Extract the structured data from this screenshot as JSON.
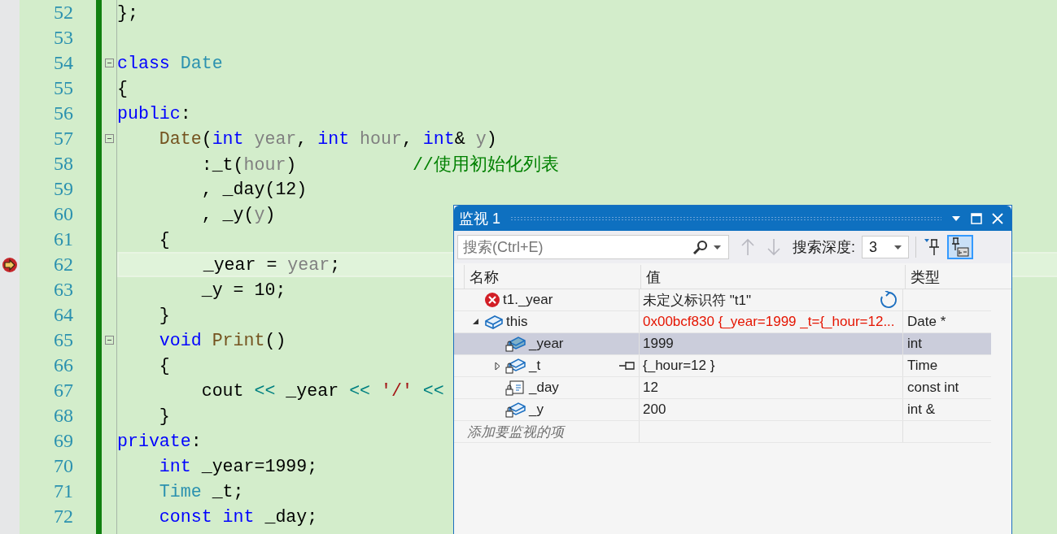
{
  "editor": {
    "lines": [
      {
        "number": "52",
        "tokens": [
          {
            "kind": "plain",
            "text": "};"
          }
        ]
      },
      {
        "number": "53"
      },
      {
        "number": "54",
        "foldable": true,
        "tokens": [
          {
            "kind": "keyword",
            "text": "class "
          },
          {
            "kind": "type",
            "text": "Date"
          }
        ]
      },
      {
        "number": "55",
        "tokens": [
          {
            "kind": "plain",
            "text": "{"
          }
        ]
      },
      {
        "number": "56",
        "tokens": [
          {
            "kind": "keyword",
            "text": "public"
          },
          {
            "kind": "plain",
            "text": ":"
          }
        ]
      },
      {
        "number": "57",
        "foldable": true,
        "tokens": [
          {
            "kind": "function",
            "text": "    Date"
          },
          {
            "kind": "plain",
            "text": "("
          },
          {
            "kind": "keyword",
            "text": "int "
          },
          {
            "kind": "param",
            "text": "year"
          },
          {
            "kind": "plain",
            "text": ", "
          },
          {
            "kind": "keyword",
            "text": "int "
          },
          {
            "kind": "param",
            "text": "hour"
          },
          {
            "kind": "plain",
            "text": ", "
          },
          {
            "kind": "keyword",
            "text": "int"
          },
          {
            "kind": "plain",
            "text": "& "
          },
          {
            "kind": "param",
            "text": "y"
          },
          {
            "kind": "plain",
            "text": ")"
          }
        ]
      },
      {
        "number": "58",
        "tokens": [
          {
            "kind": "plain",
            "text": "        :_t("
          },
          {
            "kind": "param",
            "text": "hour"
          },
          {
            "kind": "plain",
            "text": ")           "
          },
          {
            "kind": "comment",
            "text": "//使用初始化列表"
          }
        ]
      },
      {
        "number": "59",
        "tokens": [
          {
            "kind": "plain",
            "text": "        , _day(12)"
          }
        ]
      },
      {
        "number": "60",
        "tokens": [
          {
            "kind": "plain",
            "text": "        , _y("
          },
          {
            "kind": "param",
            "text": "y"
          },
          {
            "kind": "plain",
            "text": ")"
          }
        ]
      },
      {
        "number": "61",
        "tokens": [
          {
            "kind": "plain",
            "text": "    {"
          }
        ]
      },
      {
        "number": "62",
        "current": true,
        "tokens": [
          {
            "kind": "plain",
            "text": "        _year = "
          },
          {
            "kind": "param",
            "text": "year"
          },
          {
            "kind": "plain",
            "text": ";"
          }
        ]
      },
      {
        "number": "63",
        "tokens": [
          {
            "kind": "plain",
            "text": "        _y = 10;"
          }
        ]
      },
      {
        "number": "64",
        "tokens": [
          {
            "kind": "plain",
            "text": "    }"
          }
        ]
      },
      {
        "number": "65",
        "foldable": true,
        "tokens": [
          {
            "kind": "keyword",
            "text": "    void "
          },
          {
            "kind": "function",
            "text": "Print"
          },
          {
            "kind": "plain",
            "text": "()"
          }
        ]
      },
      {
        "number": "66",
        "tokens": [
          {
            "kind": "plain",
            "text": "    {"
          }
        ]
      },
      {
        "number": "67",
        "tokens": [
          {
            "kind": "plain",
            "text": "        cout "
          },
          {
            "kind": "operator",
            "text": "<< "
          },
          {
            "kind": "plain",
            "text": "_year "
          },
          {
            "kind": "operator",
            "text": "<< "
          },
          {
            "kind": "string",
            "text": "'/' "
          },
          {
            "kind": "operator",
            "text": "<<"
          }
        ]
      },
      {
        "number": "68",
        "tokens": [
          {
            "kind": "plain",
            "text": "    }"
          }
        ]
      },
      {
        "number": "69",
        "tokens": [
          {
            "kind": "keyword",
            "text": "private"
          },
          {
            "kind": "plain",
            "text": ":"
          }
        ]
      },
      {
        "number": "70",
        "tokens": [
          {
            "kind": "keyword",
            "text": "    int "
          },
          {
            "kind": "plain",
            "text": "_year=1999;"
          }
        ]
      },
      {
        "number": "71",
        "tokens": [
          {
            "kind": "type",
            "text": "    Time "
          },
          {
            "kind": "plain",
            "text": "_t;"
          }
        ]
      },
      {
        "number": "72",
        "tokens": [
          {
            "kind": "keyword",
            "text": "    const int "
          },
          {
            "kind": "plain",
            "text": "_day;"
          }
        ]
      }
    ]
  },
  "watch": {
    "title": "监视 1",
    "search": {
      "placeholder": "搜索(Ctrl+E)"
    },
    "depth_label": "搜索深度:",
    "depth_value": "3",
    "toggle_selected": true,
    "columns": [
      "名称",
      "值",
      "类型"
    ],
    "items": [
      {
        "kind": "error",
        "name": "t1._year",
        "value": "未定义标识符 \"t1\"",
        "refreshable": true,
        "changed": false,
        "selected": false
      },
      {
        "kind": "object",
        "name": "this",
        "value": "0x00bcf830 {_year=1999 _t={_hour=12...",
        "type": "Date *",
        "expanded": true,
        "changed": true,
        "selected": false,
        "children": [
          {
            "kind": "field",
            "name": "_year",
            "value": "1999",
            "type": "int",
            "changed": false,
            "selected": true
          },
          {
            "kind": "field",
            "name": "_t",
            "value": "{_hour=12 }",
            "type": "Time",
            "expanded": false,
            "pin": true,
            "changed": false,
            "selected": false
          },
          {
            "kind": "constant",
            "name": "_day",
            "value": "12",
            "type": "const int",
            "changed": false,
            "selected": false
          },
          {
            "kind": "field",
            "name": "_y",
            "value": "200",
            "type": "int &",
            "changed": false,
            "selected": false
          }
        ]
      }
    ],
    "add_placeholder": "添加要监视的项"
  }
}
